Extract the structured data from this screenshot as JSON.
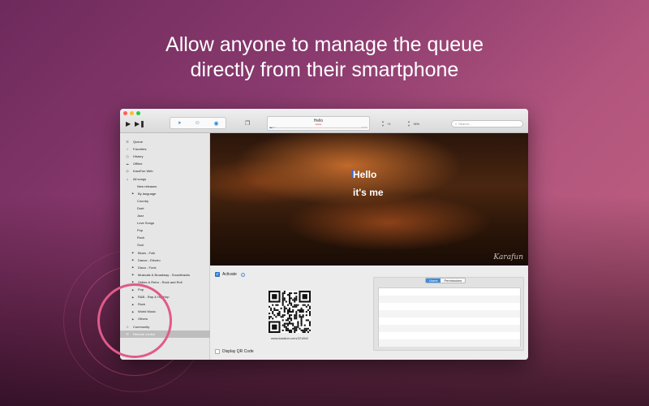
{
  "headline": {
    "line1": "Allow anyone to manage the queue",
    "line2": "directly from their smartphone"
  },
  "colors": {
    "accent_ring": "#e05a8a",
    "selection_blue": "#3b8be0",
    "traffic_close": "#fc5f57",
    "traffic_minimize": "#fdbc2e",
    "traffic_zoom": "#2ac940"
  },
  "toolbar": {
    "play_icon": "play-icon",
    "next_icon": "skip-next-icon",
    "tool_icons": [
      "speaker-icon",
      "people-icon",
      "singer-icon"
    ],
    "screen_icon": "second-screen-icon",
    "now_playing": {
      "title": "Hello",
      "artist": "Adele",
      "elapsed": "00:00",
      "remaining": "-04:52",
      "progress": 0.03
    },
    "key_value": "+1",
    "tempo_value": "+6%",
    "search_placeholder": "Search..."
  },
  "sidebar": {
    "items": [
      {
        "label": "Queue",
        "icon": "queue-icon"
      },
      {
        "label": "Favorites",
        "icon": "star-icon"
      },
      {
        "label": "History",
        "icon": "clock-icon"
      },
      {
        "label": "Offline",
        "icon": "cloud-icon"
      },
      {
        "label": "KaraFun Web",
        "icon": "globe-icon"
      },
      {
        "label": "All songs",
        "icon": "music-icon"
      }
    ],
    "subitems": [
      "New releases"
    ],
    "categories_top": [
      "By language"
    ],
    "languages": [
      "Country",
      "Duet",
      "Jazz",
      "Love Songs",
      "Pop",
      "Rock",
      "Soul"
    ],
    "genres": [
      "Blues - Folk",
      "Dance - Electro",
      "Disco - Funk",
      "Musicals & Broadway - Soundtracks",
      "Oldies & Retro - Rock and Roll",
      "Pop",
      "R&B - Rap & Hip Hop",
      "Rock",
      "World Music",
      "Others"
    ],
    "community": {
      "label": "Community",
      "icon": "community-icon"
    },
    "remote_control": {
      "label": "Remote control",
      "icon": "remote-icon"
    }
  },
  "video": {
    "lyric_line1": "Hello",
    "lyric_line2": "it's me",
    "brand": "Karafun"
  },
  "remote": {
    "activate_label": "Activate",
    "activate_checked": true,
    "qr_url": "www.karafun.com/221842",
    "display_qr_label": "Display QR Code",
    "display_qr_checked": false,
    "tab_users": "Users",
    "tab_permissions": "Permissions"
  }
}
